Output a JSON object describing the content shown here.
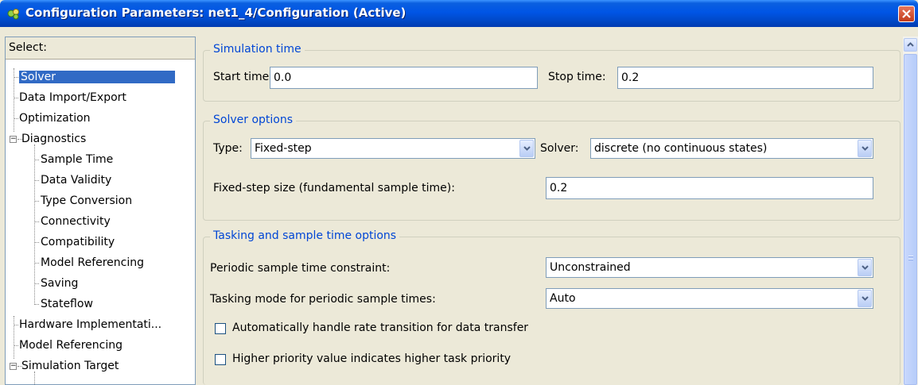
{
  "window": {
    "title": "Configuration Parameters: net1_4/Configuration (Active)",
    "icon": "simulink-config-icon",
    "close_icon": "close-icon"
  },
  "tree": {
    "header": "Select:",
    "items": [
      {
        "label": "Solver",
        "level": 1,
        "selected": true
      },
      {
        "label": "Data Import/Export",
        "level": 1
      },
      {
        "label": "Optimization",
        "level": 1
      },
      {
        "label": "Diagnostics",
        "level": 0,
        "expander": "minus"
      },
      {
        "label": "Sample Time",
        "level": 2
      },
      {
        "label": "Data Validity",
        "level": 2
      },
      {
        "label": "Type Conversion",
        "level": 2
      },
      {
        "label": "Connectivity",
        "level": 2
      },
      {
        "label": "Compatibility",
        "level": 2
      },
      {
        "label": "Model Referencing",
        "level": 2
      },
      {
        "label": "Saving",
        "level": 2
      },
      {
        "label": "Stateflow",
        "level": 2
      },
      {
        "label": "Hardware Implementati...",
        "level": 1
      },
      {
        "label": "Model Referencing",
        "level": 1
      },
      {
        "label": "Simulation Target",
        "level": 0,
        "expander": "minus"
      }
    ]
  },
  "simulation_time": {
    "legend": "Simulation time",
    "start_label": "Start time:",
    "start_value": "0.0",
    "stop_label": "Stop time:",
    "stop_value": "0.2"
  },
  "solver_options": {
    "legend": "Solver options",
    "type_label": "Type:",
    "type_value": "Fixed-step",
    "solver_label": "Solver:",
    "solver_value": "discrete (no continuous states)",
    "step_label": "Fixed-step size (fundamental sample time):",
    "step_value": "0.2"
  },
  "tasking": {
    "legend": "Tasking and sample time options",
    "periodic_label": "Periodic sample time constraint:",
    "periodic_value": "Unconstrained",
    "mode_label": "Tasking mode for periodic sample times:",
    "mode_value": "Auto",
    "rate_transition_label": "Automatically handle rate transition for data transfer",
    "rate_transition_checked": false,
    "priority_label": "Higher priority value indicates higher task priority",
    "priority_checked": false
  },
  "colors": {
    "titlebar": "#0055e5",
    "selection": "#316ac5",
    "legend_text": "#0046d5",
    "dialog_bg": "#ece9d8"
  }
}
